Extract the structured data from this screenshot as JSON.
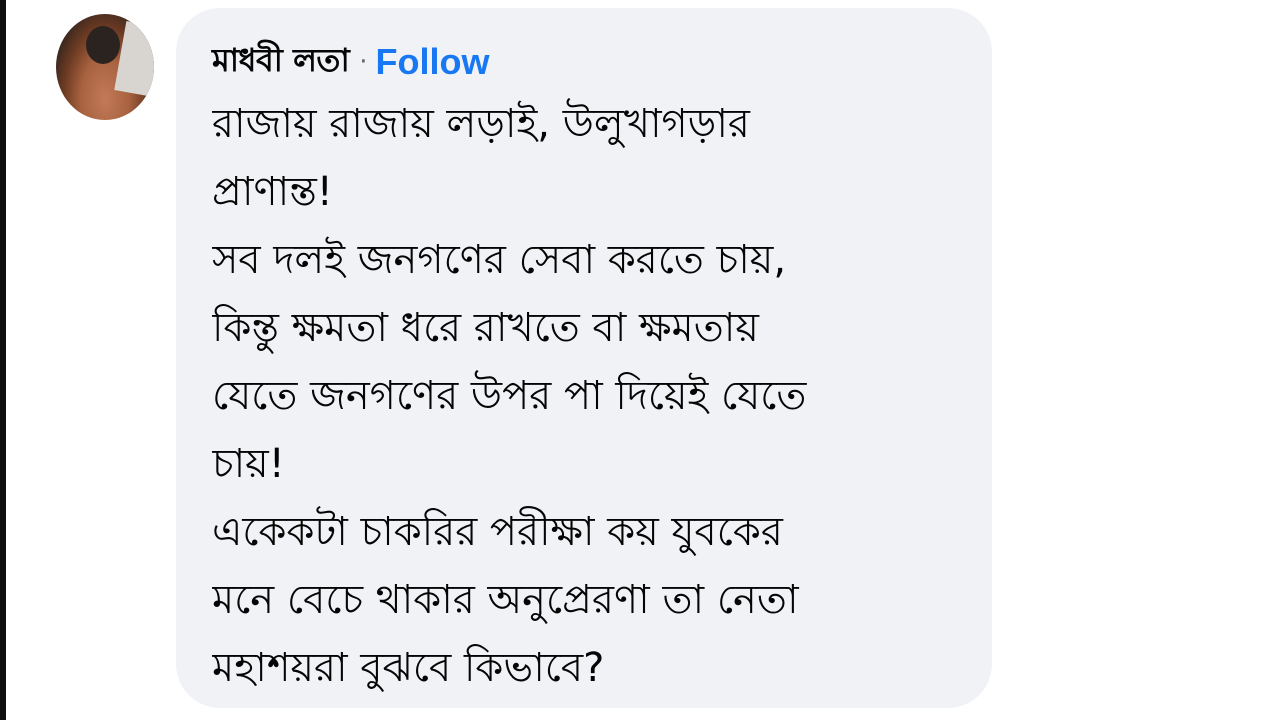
{
  "comment": {
    "author": "মাধবী লতা",
    "separator": "·",
    "follow_label": "Follow",
    "lines": [
      "রাজায় রাজায় লড়াই, উলুখাগড়ার",
      "প্রাণান্ত!",
      "সব দলই জনগণের সেবা করতে চায়,",
      "কিন্তু ক্ষমতা ধরে রাখতে বা ক্ষমতায়",
      "যেতে জনগণের উপর পা দিয়েই যেতে",
      "চায়!",
      "একেকটা চাকরির পরীক্ষা কয় যুবকের",
      "মনে বেচে থাকার অনুপ্রেরণা তা নেতা",
      "মহাশয়রা বুঝবে কিভাবে?"
    ]
  },
  "colors": {
    "bubble_bg": "#f0f2f5",
    "follow_link": "#1877f2",
    "text": "#050505"
  },
  "icons": {
    "avatar": "profile-photo"
  }
}
